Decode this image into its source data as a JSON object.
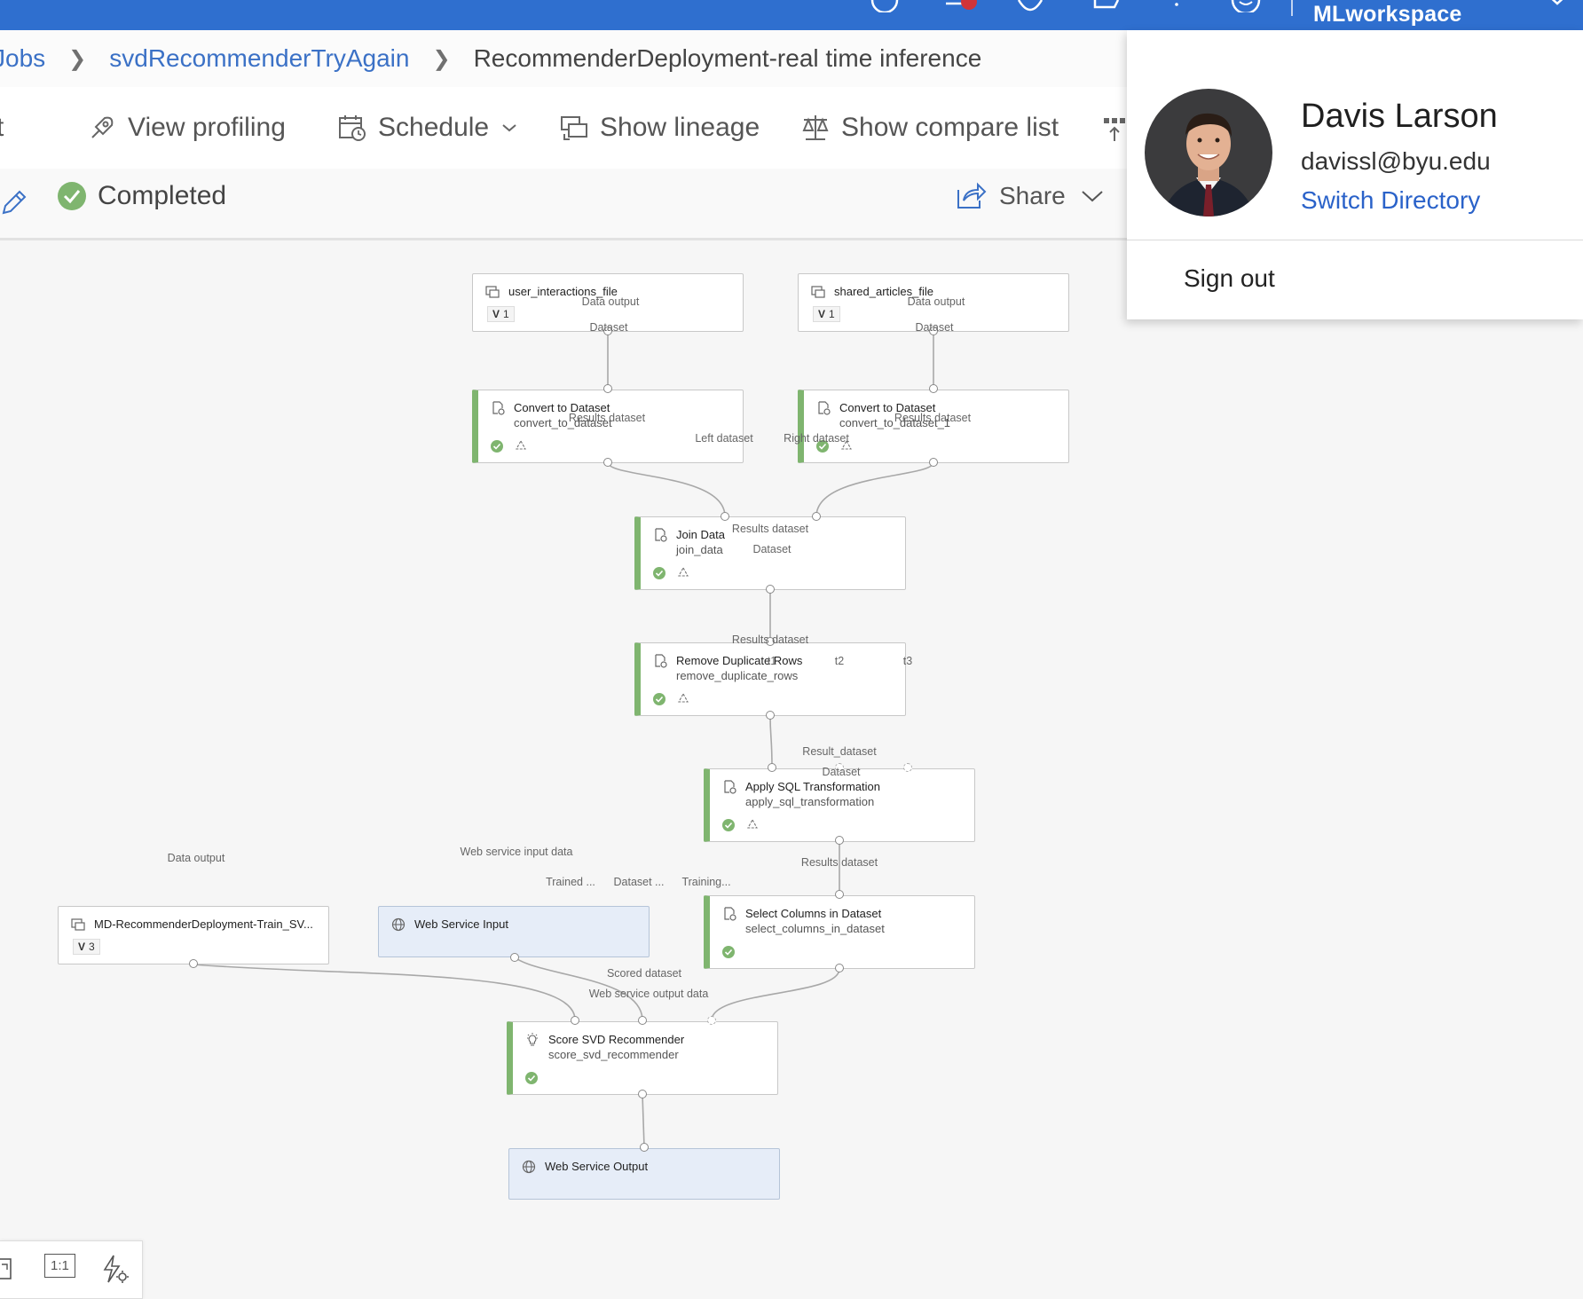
{
  "topbar": {
    "workspace": "MLworkspace",
    "color": "#2f6fcf",
    "icons": [
      "help-circle-icon",
      "bell-icon",
      "gear-icon",
      "feedback-icon",
      "question-icon",
      "smiley-icon",
      "chevron-down-icon"
    ]
  },
  "breadcrumb": {
    "items": [
      "Jobs",
      "svdRecommenderTryAgain"
    ],
    "current": "RecommenderDeployment-real time inference"
  },
  "toolbar": {
    "truncated_left": "t",
    "view_profiling": "View profiling",
    "schedule": "Schedule",
    "show_lineage": "Show lineage",
    "show_compare_list": "Show compare list"
  },
  "status": {
    "state": "Completed",
    "share": "Share",
    "color": "#7fb56f"
  },
  "nodes": {
    "user_interactions": {
      "title": "user_interactions_file",
      "version_label": "V",
      "version": "1"
    },
    "shared_articles": {
      "title": "shared_articles_file",
      "version_label": "V",
      "version": "1"
    },
    "convert1": {
      "title": "Convert to Dataset",
      "sub": "convert_to_dataset"
    },
    "convert2": {
      "title": "Convert to Dataset",
      "sub": "convert_to_dataset_1"
    },
    "join": {
      "title": "Join Data",
      "sub": "join_data"
    },
    "dedupe": {
      "title": "Remove Duplicate Rows",
      "sub": "remove_duplicate_rows"
    },
    "sql": {
      "title": "Apply SQL Transformation",
      "sub": "apply_sql_transformation"
    },
    "select": {
      "title": "Select Columns in Dataset",
      "sub": "select_columns_in_dataset"
    },
    "md": {
      "title": "MD-RecommenderDeployment-Train_SV...",
      "version_label": "V",
      "version": "3"
    },
    "wsi": {
      "title": "Web Service Input"
    },
    "score": {
      "title": "Score SVD Recommender",
      "sub": "score_svd_recommender"
    },
    "wso": {
      "title": "Web Service Output"
    }
  },
  "ports": {
    "data_output": "Data output",
    "dataset": "Dataset",
    "results_dataset": "Results dataset",
    "left_dataset": "Left dataset",
    "right_dataset": "Right dataset",
    "t1": "t1",
    "t2": "t2",
    "t3": "t3",
    "result_dataset": "Result_dataset",
    "web_service_input_data": "Web service input data",
    "trained": "Trained ...",
    "dataset_trunc": "Dataset ...",
    "training": "Training...",
    "scored_dataset": "Scored dataset",
    "web_service_output_data": "Web service output data"
  },
  "zoom": {
    "fit": "1:1"
  },
  "user": {
    "name": "Davis Larson",
    "email": "davissl@byu.edu",
    "switch_directory": "Switch Directory",
    "sign_out": "Sign out"
  }
}
